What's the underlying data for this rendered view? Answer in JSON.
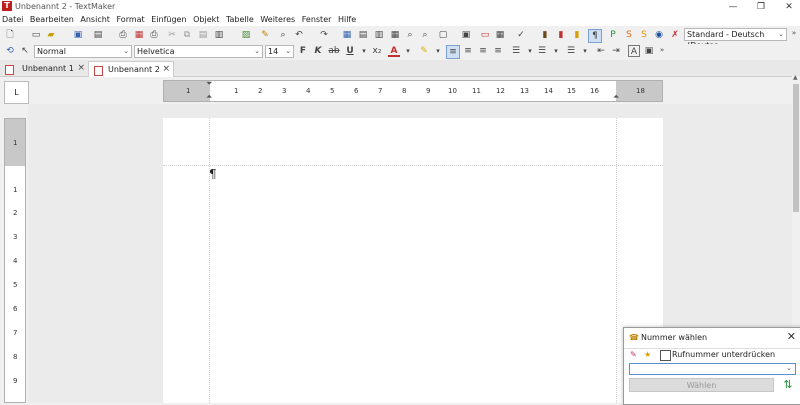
{
  "window": {
    "title": "Unbenannt 2 - TextMaker",
    "app_icon_letter": "T",
    "minimize": "—",
    "restore": "❐",
    "close": "✕"
  },
  "menu": [
    "Datei",
    "Bearbeiten",
    "Ansicht",
    "Format",
    "Einfügen",
    "Objekt",
    "Tabelle",
    "Weiteres",
    "Fenster",
    "Hilfe"
  ],
  "toolbar": {
    "language_combo": "Standard - Deutsch (Deutsc",
    "style_combo": "Normal",
    "font_combo": "Helvetica",
    "size_combo": "14",
    "bold_label": "F",
    "italic_label": "K",
    "strike_label": "ab",
    "underline_label": "U",
    "subscript_label": "x₂"
  },
  "tabs": [
    {
      "label": "Unbenannt 1",
      "close": "×"
    },
    {
      "label": "Unbenannt 2",
      "close": "×"
    }
  ],
  "ruler": {
    "corner": "L",
    "h_ticks": [
      "1",
      "1",
      "2",
      "3",
      "4",
      "5",
      "6",
      "7",
      "8",
      "9",
      "10",
      "11",
      "12",
      "13",
      "14",
      "15",
      "16",
      "18"
    ],
    "v_ticks": [
      "1",
      "1",
      "2",
      "3",
      "4",
      "5",
      "6",
      "7",
      "8",
      "9"
    ]
  },
  "document": {
    "paragraph_mark": "¶"
  },
  "dialog": {
    "title": "Nummer wählen",
    "close": "✕",
    "checkbox_label": "Rufnummer unterdrücken",
    "checkbox_checked": false,
    "number_value": "",
    "dial_button": "Wählen"
  },
  "colors": {
    "accent": "#c0201d",
    "ruler_margin": "#c8c8c8",
    "page_bg": "#ffffff",
    "workspace_bg": "#ebebeb"
  }
}
